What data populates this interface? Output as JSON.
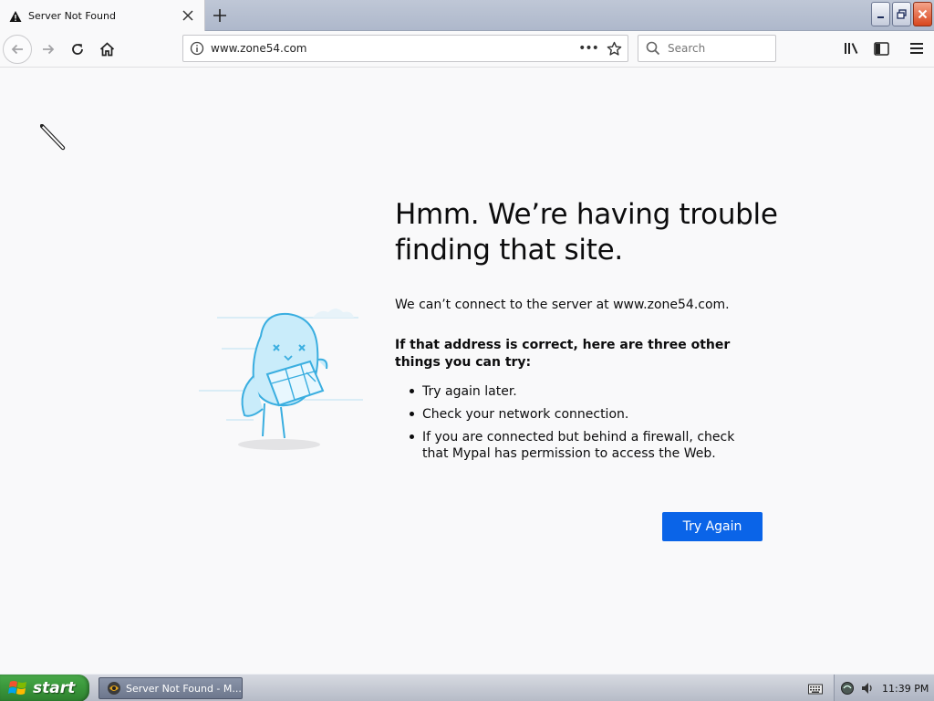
{
  "tab": {
    "title": "Server Not Found"
  },
  "nav": {
    "url": "www.zone54.com",
    "search_placeholder": "Search",
    "page_actions": "•••"
  },
  "content": {
    "heading": "Hmm. We’re having trouble finding that site.",
    "description": "We can’t connect to the server at www.zone54.com.",
    "tips_heading": "If that address is correct, here are three other things you can try:",
    "tips": [
      "Try again later.",
      "Check your network connection.",
      "If you are connected but behind a firewall, check that Mypal has permission to access the Web."
    ],
    "try_again_label": "Try Again"
  },
  "taskbar": {
    "start_label": "start",
    "task_label": "Server Not Found - M...",
    "clock": "11:39 PM"
  },
  "colors": {
    "accent": "#0a64e8",
    "illustration": "#3aaee0"
  }
}
